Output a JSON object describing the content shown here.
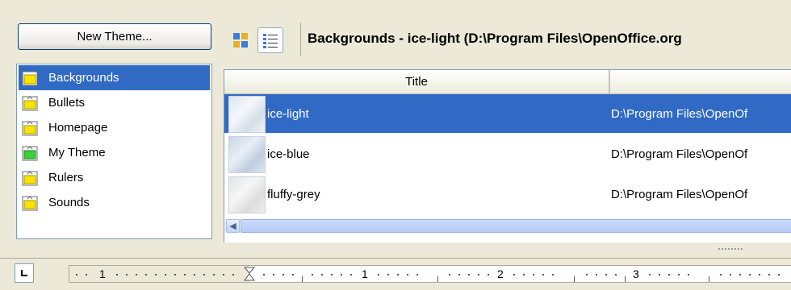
{
  "new_theme_button": "New Theme...",
  "themes": [
    {
      "label": "Backgrounds",
      "selected": true,
      "icon": "folder-yellow-icon"
    },
    {
      "label": "Bullets",
      "selected": false,
      "icon": "folder-yellow-icon"
    },
    {
      "label": "Homepage",
      "selected": false,
      "icon": "folder-yellow-icon"
    },
    {
      "label": "My Theme",
      "selected": false,
      "icon": "folder-green-icon"
    },
    {
      "label": "Rulers",
      "selected": false,
      "icon": "folder-yellow-icon"
    },
    {
      "label": "Sounds",
      "selected": false,
      "icon": "folder-yellow-icon"
    }
  ],
  "path_title": "Backgrounds - ice-light (D:\\Program Files\\OpenOffice.org",
  "table": {
    "headers": {
      "title": "Title",
      "path": ""
    },
    "rows": [
      {
        "title": "ice-light",
        "path": "D:\\Program Files\\OpenOf",
        "selected": true
      },
      {
        "title": "ice-blue",
        "path": "D:\\Program Files\\OpenOf",
        "selected": false
      },
      {
        "title": "fluffy-grey",
        "path": "D:\\Program Files\\OpenOf",
        "selected": false
      }
    ]
  },
  "ruler": {
    "labels": [
      "1",
      "1",
      "2",
      "3"
    ]
  },
  "colors": {
    "selection": "#316ac5",
    "face": "#ece9d8"
  }
}
